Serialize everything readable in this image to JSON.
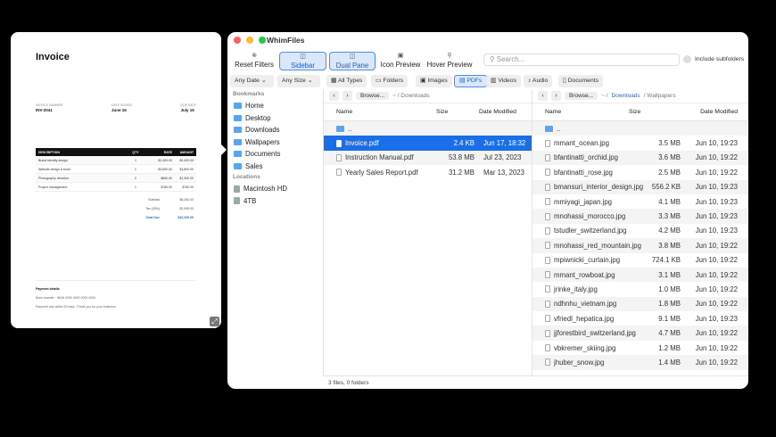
{
  "preview": {
    "title": "Invoice",
    "meta": [
      {
        "label": "INVOICE NUMBER",
        "value": "INV-2041"
      },
      {
        "label": "DATE ISSUED",
        "value": "June 15"
      },
      {
        "label": "DUE DATE",
        "value": "July 15"
      }
    ],
    "table_headers": [
      "DESCRIPTION",
      "QTY",
      "RATE",
      "AMOUNT"
    ],
    "rows": [
      {
        "desc": "Brand identity design",
        "qty": "1",
        "rate": "$2,400.00",
        "amount": "$2,400.00"
      },
      {
        "desc": "Website design & build",
        "qty": "1",
        "rate": "$3,800.00",
        "amount": "$3,800.00"
      },
      {
        "desc": "Photography direction",
        "qty": "2",
        "rate": "$650.00",
        "amount": "$1,300.00"
      },
      {
        "desc": "Project management",
        "qty": "1",
        "rate": "$760.00",
        "amount": "$760.00"
      }
    ],
    "subtotal_label": "Subtotal",
    "subtotal": "$8,260.00",
    "tax_label": "Tax (25%)",
    "tax": "$2,065.00",
    "due_label": "Total Due",
    "due": "$10,325.00",
    "pay_title": "Payment details",
    "pay_line1": "Bank transfer · IBAN 0000 0000 0000 0000",
    "pay_line2": "Payment due within 30 days. Thank you for your business."
  },
  "window": {
    "title": "WhimFiles",
    "toolbar": [
      {
        "label": "Reset Filters",
        "icon": "⊗"
      },
      {
        "label": "Sidebar",
        "icon": "◫"
      },
      {
        "label": "Dual Pane",
        "icon": "◫"
      },
      {
        "label": "Icon Preview",
        "icon": "▣"
      },
      {
        "label": "Hover Preview",
        "icon": "⚲"
      }
    ],
    "search_placeholder": "Search...",
    "include_subfolders": "Include subfolders",
    "filters": {
      "date": "Any Date",
      "size": "Any Size",
      "types": [
        "All Types",
        "Folders",
        "Images",
        "PDFs",
        "Videos",
        "Audio",
        "Documents"
      ]
    },
    "sidebar": {
      "bookmarks_label": "Bookmarks",
      "bookmarks": [
        "Home",
        "Desktop",
        "Downloads",
        "Wallpapers",
        "Documents",
        "Sales"
      ],
      "locations_label": "Locations",
      "locations": [
        "Macintosh HD",
        "4TB"
      ]
    },
    "left_pane": {
      "browse": "Browse...",
      "path": "~ / Downloads",
      "columns": [
        "Name",
        "Size",
        "Date Modified"
      ],
      "files": [
        {
          "name": "..",
          "size": "",
          "date": ""
        },
        {
          "name": "Invoice.pdf",
          "size": "2.4 KB",
          "date": "Jun 17, 18:32"
        },
        {
          "name": "Instruction Manual.pdf",
          "size": "53.8 MB",
          "date": "Jul 23, 2023"
        },
        {
          "name": "Yearly Sales Report.pdf",
          "size": "31.2 MB",
          "date": "Mar 13, 2023"
        }
      ]
    },
    "right_pane": {
      "browse": "Browse...",
      "path_home": "~ /",
      "path_parent": "Downloads",
      "path_current": "/ Wallpapers",
      "columns": [
        "Name",
        "Size",
        "Date Modified"
      ],
      "files": [
        {
          "name": "..",
          "size": "",
          "date": ""
        },
        {
          "name": "mmant_ocean.jpg",
          "size": "3.5 MB",
          "date": "Jun 10, 19:23"
        },
        {
          "name": "bfantinatti_orchid.jpg",
          "size": "3.6 MB",
          "date": "Jun 10, 19:22"
        },
        {
          "name": "bfantinatti_rose.jpg",
          "size": "2.5 MB",
          "date": "Jun 10, 19:22"
        },
        {
          "name": "bmansuri_interior_design.jpg",
          "size": "556.2 KB",
          "date": "Jun 10, 19:23"
        },
        {
          "name": "mmiyagi_japan.jpg",
          "size": "4.1 MB",
          "date": "Jun 10, 19:23"
        },
        {
          "name": "mnohassi_morocco.jpg",
          "size": "3.3 MB",
          "date": "Jun 10, 19:23"
        },
        {
          "name": "tstudler_switzerland.jpg",
          "size": "4.2 MB",
          "date": "Jun 10, 19:23"
        },
        {
          "name": "mnohassi_red_mountain.jpg",
          "size": "3.8 MB",
          "date": "Jun 10, 19:22"
        },
        {
          "name": "mpiwnicki_curtain.jpg",
          "size": "724.1 KB",
          "date": "Jun 10, 19:22"
        },
        {
          "name": "mmant_rowboat.jpg",
          "size": "3.1 MB",
          "date": "Jun 10, 19:22"
        },
        {
          "name": "jrinke_italy.jpg",
          "size": "1.0 MB",
          "date": "Jun 10, 19:22"
        },
        {
          "name": "ndhnhu_vietnam.jpg",
          "size": "1.8 MB",
          "date": "Jun 10, 19:22"
        },
        {
          "name": "vfriedl_hepatica.jpg",
          "size": "9.1 MB",
          "date": "Jun 10, 19:23"
        },
        {
          "name": "jjforestbird_switzerland.jpg",
          "size": "4.7 MB",
          "date": "Jun 10, 19:22"
        },
        {
          "name": "vbkremer_skiing.jpg",
          "size": "1.2 MB",
          "date": "Jun 10, 19:22"
        },
        {
          "name": "jhuber_snow.jpg",
          "size": "1.4 MB",
          "date": "Jun 10, 19:22"
        }
      ]
    },
    "status": "3 files, 0 folders"
  }
}
